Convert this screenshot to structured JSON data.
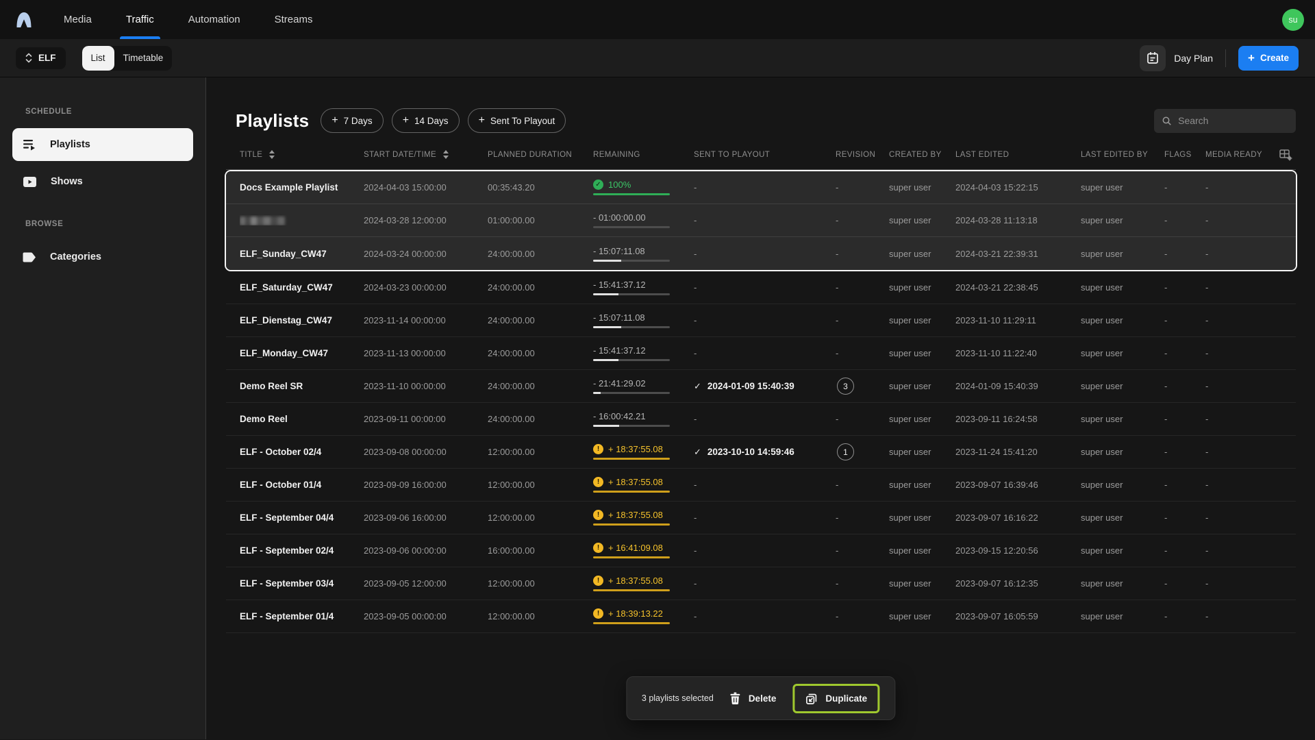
{
  "nav": {
    "items": [
      "Media",
      "Traffic",
      "Automation",
      "Streams"
    ],
    "active": "Traffic",
    "avatar_initials": "su"
  },
  "toolbar": {
    "channel": "ELF",
    "views": [
      "List",
      "Timetable"
    ],
    "active_view": "List",
    "day_plan_label": "Day Plan",
    "create_label": "Create"
  },
  "sidebar": {
    "sections": [
      {
        "label": "SCHEDULE",
        "items": [
          {
            "label": "Playlists",
            "active": true
          },
          {
            "label": "Shows",
            "active": false
          }
        ]
      },
      {
        "label": "BROWSE",
        "items": [
          {
            "label": "Categories",
            "active": false
          }
        ]
      }
    ]
  },
  "main": {
    "title": "Playlists",
    "quick_actions": [
      {
        "label": "7 Days"
      },
      {
        "label": "14 Days"
      },
      {
        "label": "Sent To Playout"
      }
    ],
    "search_placeholder": "Search"
  },
  "table": {
    "columns": [
      {
        "label": "TITLE",
        "sortable": true
      },
      {
        "label": "START DATE/TIME",
        "sortable": true
      },
      {
        "label": "PLANNED DURATION",
        "sortable": false
      },
      {
        "label": "REMAINING",
        "sortable": false
      },
      {
        "label": "SENT TO PLAYOUT",
        "sortable": false
      },
      {
        "label": "REVISION",
        "sortable": false
      },
      {
        "label": "CREATED BY",
        "sortable": false
      },
      {
        "label": "LAST EDITED",
        "sortable": false
      },
      {
        "label": "LAST EDITED BY",
        "sortable": false
      },
      {
        "label": "FLAGS",
        "sortable": false
      },
      {
        "label": "MEDIA READY",
        "sortable": false
      }
    ],
    "rows": [
      {
        "title": "Docs Example Playlist",
        "redacted": false,
        "selected": true,
        "start": "2024-04-03 15:00:00",
        "planned": "00:35:43.20",
        "remaining": {
          "state": "complete",
          "text": "100%",
          "progress": 1
        },
        "sent": "-",
        "revision": "-",
        "created_by": "super user",
        "last_edited": "2024-04-03 15:22:15",
        "last_edited_by": "super user",
        "flags": "-",
        "media_ready": "-"
      },
      {
        "title": "",
        "redacted": true,
        "selected": true,
        "start": "2024-03-28 12:00:00",
        "planned": "01:00:00.00",
        "remaining": {
          "state": "neutral",
          "text": "- 01:00:00.00",
          "progress": 0
        },
        "sent": "-",
        "revision": "-",
        "created_by": "super user",
        "last_edited": "2024-03-28 11:13:18",
        "last_edited_by": "super user",
        "flags": "-",
        "media_ready": "-"
      },
      {
        "title": "ELF_Sunday_CW47",
        "redacted": false,
        "selected": true,
        "start": "2024-03-24 00:00:00",
        "planned": "24:00:00.00",
        "remaining": {
          "state": "neutral",
          "text": "- 15:07:11.08",
          "progress": 0.37
        },
        "sent": "-",
        "revision": "-",
        "created_by": "super user",
        "last_edited": "2024-03-21 22:39:31",
        "last_edited_by": "super user",
        "flags": "-",
        "media_ready": "-"
      },
      {
        "title": "ELF_Saturday_CW47",
        "redacted": false,
        "selected": false,
        "start": "2024-03-23 00:00:00",
        "planned": "24:00:00.00",
        "remaining": {
          "state": "neutral",
          "text": "- 15:41:37.12",
          "progress": 0.33
        },
        "sent": "-",
        "revision": "-",
        "created_by": "super user",
        "last_edited": "2024-03-21 22:38:45",
        "last_edited_by": "super user",
        "flags": "-",
        "media_ready": "-"
      },
      {
        "title": "ELF_Dienstag_CW47",
        "redacted": false,
        "selected": false,
        "start": "2023-11-14 00:00:00",
        "planned": "24:00:00.00",
        "remaining": {
          "state": "neutral",
          "text": "- 15:07:11.08",
          "progress": 0.37
        },
        "sent": "-",
        "revision": "-",
        "created_by": "super user",
        "last_edited": "2023-11-10 11:29:11",
        "last_edited_by": "super user",
        "flags": "-",
        "media_ready": "-"
      },
      {
        "title": "ELF_Monday_CW47",
        "redacted": false,
        "selected": false,
        "start": "2023-11-13 00:00:00",
        "planned": "24:00:00.00",
        "remaining": {
          "state": "neutral",
          "text": "- 15:41:37.12",
          "progress": 0.33
        },
        "sent": "-",
        "revision": "-",
        "created_by": "super user",
        "last_edited": "2023-11-10 11:22:40",
        "last_edited_by": "super user",
        "flags": "-",
        "media_ready": "-"
      },
      {
        "title": "Demo Reel SR",
        "redacted": false,
        "selected": false,
        "start": "2023-11-10 00:00:00",
        "planned": "24:00:00.00",
        "remaining": {
          "state": "neutral",
          "text": "- 21:41:29.02",
          "progress": 0.1
        },
        "sent": "2024-01-09 15:40:39",
        "revision": "3",
        "created_by": "super user",
        "last_edited": "2024-01-09 15:40:39",
        "last_edited_by": "super user",
        "flags": "-",
        "media_ready": "-"
      },
      {
        "title": "Demo Reel",
        "redacted": false,
        "selected": false,
        "start": "2023-09-11 00:00:00",
        "planned": "24:00:00.00",
        "remaining": {
          "state": "neutral",
          "text": "- 16:00:42.21",
          "progress": 0.34
        },
        "sent": "-",
        "revision": "-",
        "created_by": "super user",
        "last_edited": "2023-09-11 16:24:58",
        "last_edited_by": "super user",
        "flags": "-",
        "media_ready": "-"
      },
      {
        "title": "ELF - October 02/4",
        "redacted": false,
        "selected": false,
        "start": "2023-09-08 00:00:00",
        "planned": "12:00:00.00",
        "remaining": {
          "state": "warning",
          "text": "+ 18:37:55.08",
          "progress": 1
        },
        "sent": "2023-10-10 14:59:46",
        "revision": "1",
        "created_by": "super user",
        "last_edited": "2023-11-24 15:41:20",
        "last_edited_by": "super user",
        "flags": "-",
        "media_ready": "-"
      },
      {
        "title": "ELF - October 01/4",
        "redacted": false,
        "selected": false,
        "start": "2023-09-09 16:00:00",
        "planned": "12:00:00.00",
        "remaining": {
          "state": "warning",
          "text": "+ 18:37:55.08",
          "progress": 1
        },
        "sent": "-",
        "revision": "-",
        "created_by": "super user",
        "last_edited": "2023-09-07 16:39:46",
        "last_edited_by": "super user",
        "flags": "-",
        "media_ready": "-"
      },
      {
        "title": "ELF - September 04/4",
        "redacted": false,
        "selected": false,
        "start": "2023-09-06 16:00:00",
        "planned": "12:00:00.00",
        "remaining": {
          "state": "warning",
          "text": "+ 18:37:55.08",
          "progress": 1
        },
        "sent": "-",
        "revision": "-",
        "created_by": "super user",
        "last_edited": "2023-09-07 16:16:22",
        "last_edited_by": "super user",
        "flags": "-",
        "media_ready": "-"
      },
      {
        "title": "ELF - September 02/4",
        "redacted": false,
        "selected": false,
        "start": "2023-09-06 00:00:00",
        "planned": "16:00:00.00",
        "remaining": {
          "state": "warning",
          "text": "+ 16:41:09.08",
          "progress": 1
        },
        "sent": "-",
        "revision": "-",
        "created_by": "super user",
        "last_edited": "2023-09-15 12:20:56",
        "last_edited_by": "super user",
        "flags": "-",
        "media_ready": "-"
      },
      {
        "title": "ELF - September 03/4",
        "redacted": false,
        "selected": false,
        "start": "2023-09-05 12:00:00",
        "planned": "12:00:00.00",
        "remaining": {
          "state": "warning",
          "text": "+ 18:37:55.08",
          "progress": 1
        },
        "sent": "-",
        "revision": "-",
        "created_by": "super user",
        "last_edited": "2023-09-07 16:12:35",
        "last_edited_by": "super user",
        "flags": "-",
        "media_ready": "-"
      },
      {
        "title": "ELF - September 01/4",
        "redacted": false,
        "selected": false,
        "start": "2023-09-05 00:00:00",
        "planned": "12:00:00.00",
        "remaining": {
          "state": "warning",
          "text": "+ 18:39:13.22",
          "progress": 1
        },
        "sent": "-",
        "revision": "-",
        "created_by": "super user",
        "last_edited": "2023-09-07 16:05:59",
        "last_edited_by": "super user",
        "flags": "-",
        "media_ready": "-"
      }
    ]
  },
  "selection_bar": {
    "summary": "3 playlists selected",
    "delete_label": "Delete",
    "duplicate_label": "Duplicate"
  },
  "colors": {
    "accent_blue": "#1b7ef2",
    "success_green": "#3bc566",
    "warning_amber": "#f2b824",
    "highlight_green": "#9fc82e",
    "avatar_green": "#3fc65c"
  }
}
